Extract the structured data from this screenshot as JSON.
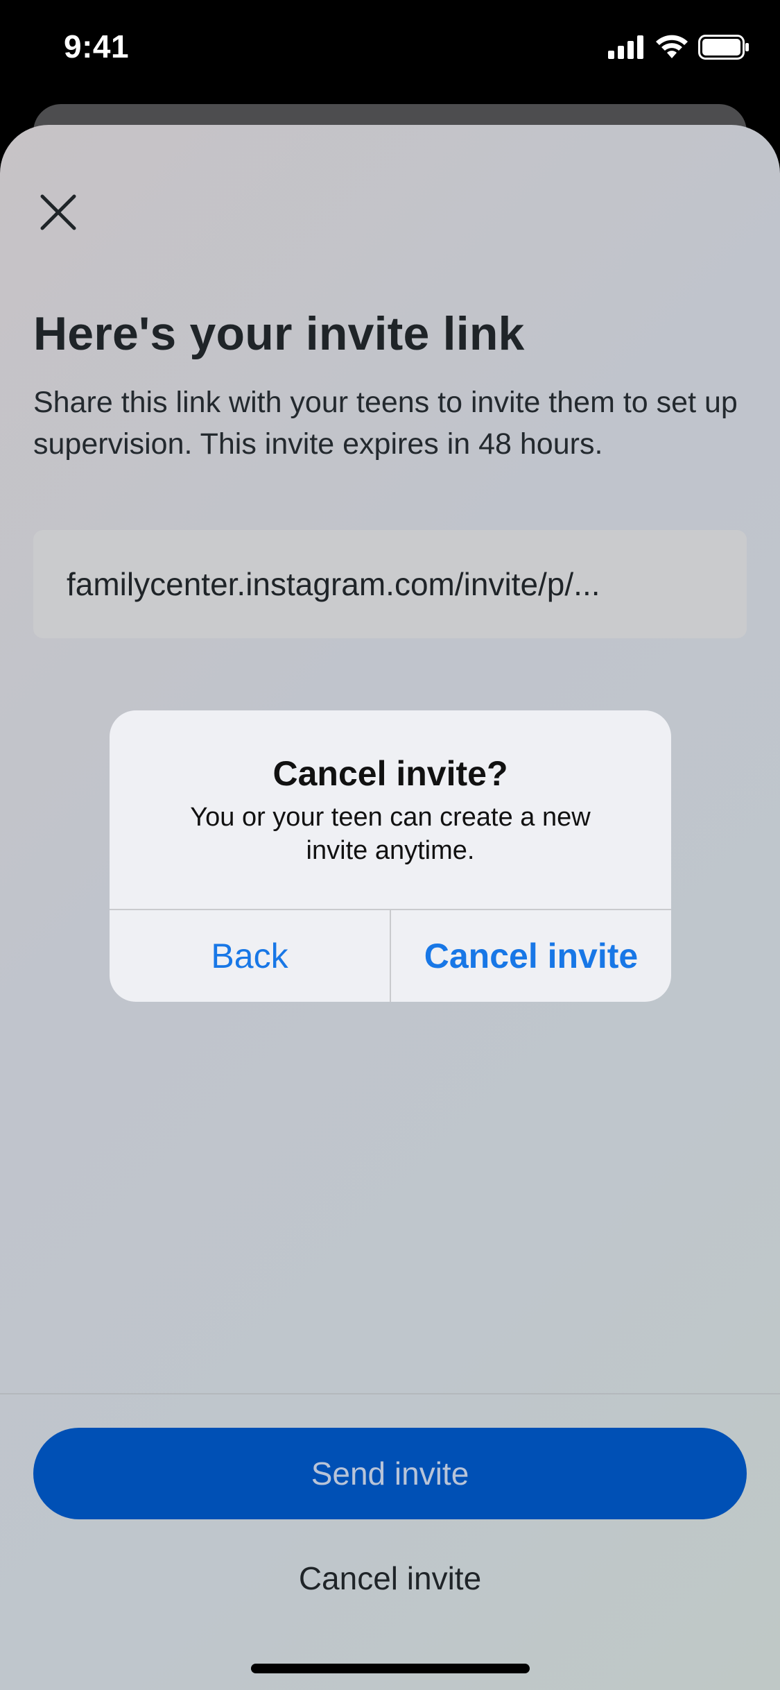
{
  "status_bar": {
    "time": "9:41",
    "icons": [
      "cellular-signal-icon",
      "wifi-icon",
      "battery-icon"
    ]
  },
  "sheet": {
    "close_icon": "close-icon",
    "title": "Here's your invite link",
    "description": "Share this link with your teens to invite them to set up supervision. This invite expires in 48 hours.",
    "invite_link": "familycenter.instagram.com/invite/p/..."
  },
  "footer": {
    "primary_label": "Send invite",
    "secondary_label": "Cancel invite"
  },
  "alert": {
    "title": "Cancel invite?",
    "message": "You or your teen can create a new invite anytime.",
    "back_label": "Back",
    "confirm_label": "Cancel invite"
  },
  "colors": {
    "primary_button": "#0050b5",
    "alert_action": "#1877e6",
    "alert_bg": "#eff0f4"
  }
}
